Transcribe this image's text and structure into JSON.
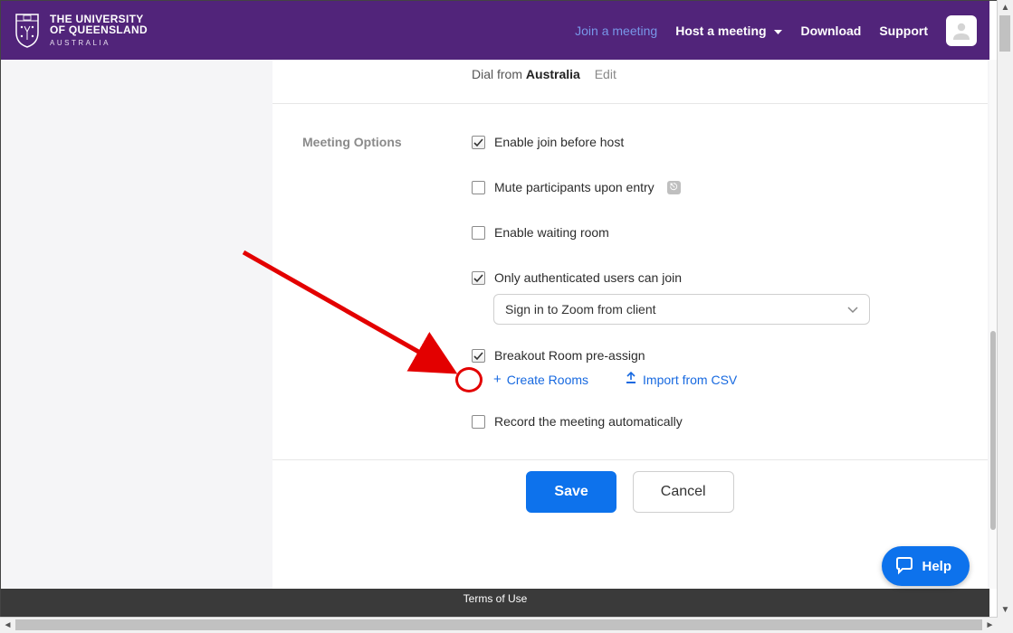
{
  "header": {
    "uni_line1": "THE UNIVERSITY",
    "uni_line2": "OF QUEENSLAND",
    "uni_line3": "AUSTRALIA",
    "nav": {
      "join": "Join a meeting",
      "host": "Host a meeting",
      "download": "Download",
      "support": "Support"
    }
  },
  "dial": {
    "prefix": "Dial from",
    "country": "Australia",
    "edit": "Edit"
  },
  "section_label": "Meeting Options",
  "options": {
    "join_before_host": "Enable join before host",
    "mute_on_entry": "Mute participants upon entry",
    "waiting_room": "Enable waiting room",
    "auth_users": "Only authenticated users can join",
    "auth_select": "Sign in to Zoom from client",
    "breakout": "Breakout Room pre-assign",
    "create_rooms": "Create Rooms",
    "import_csv": "Import from CSV",
    "record_auto": "Record the meeting automatically"
  },
  "buttons": {
    "save": "Save",
    "cancel": "Cancel"
  },
  "footer": {
    "terms": "Terms of Use"
  },
  "help_label": "Help"
}
